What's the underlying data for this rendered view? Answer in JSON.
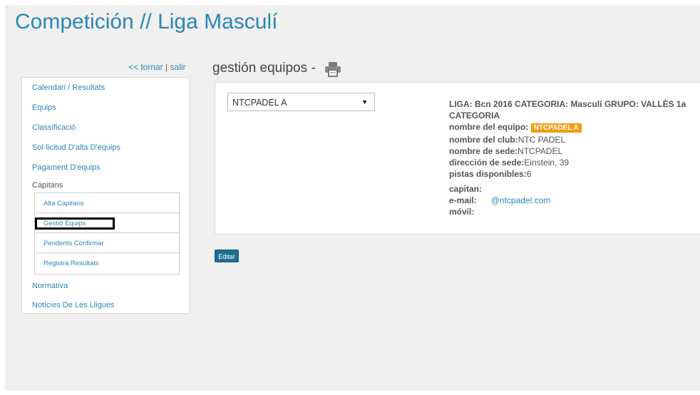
{
  "page": {
    "title": "Competición // Liga Masculí"
  },
  "back_links": {
    "back": "<< tornar",
    "separator": "|",
    "exit": "salir"
  },
  "sidebar": {
    "items": [
      {
        "label": "Calendari / Resultats"
      },
      {
        "label": "Equips"
      },
      {
        "label": "Classificació"
      },
      {
        "label": "Sol·licitud D'alta D'equips"
      },
      {
        "label": "Pagament D'equips"
      },
      {
        "label": "Capitans"
      },
      {
        "label": "Normativa"
      },
      {
        "label": "Notícies De Les Lligues"
      }
    ],
    "submenu": [
      {
        "label": "Alta Capitans"
      },
      {
        "label": "Gestió Equips"
      },
      {
        "label": "Pendents Confirmar"
      },
      {
        "label": "Registra Resultats"
      }
    ]
  },
  "main": {
    "section_title": "gestión equipos -",
    "print_icon": "printer-icon",
    "team_select": {
      "selected": "NTCPADEL A"
    },
    "info": {
      "line1": "LIGA: Bcn 2016 CATEGORIA: Masculí GRUPO: VALLÈS 1a",
      "line2": "CATEGORIA",
      "team_label": "nombre del equipo:",
      "team_value": "NTCPADEL A",
      "club_label": "nombre del club:",
      "club_value": "NTC PADEL",
      "venue_label": "nombre de sede:",
      "venue_value": "NTCPADEL",
      "address_label": "dirección de sede:",
      "address_value": "Einstein, 39",
      "courts_label": "pistas disponibles:",
      "courts_value": "6",
      "captain_label": "capitan:",
      "email_label": "e-mail:",
      "email_value": "@ntcpadel.com",
      "mobile_label": "móvil:"
    },
    "edit_button": "Editar"
  }
}
